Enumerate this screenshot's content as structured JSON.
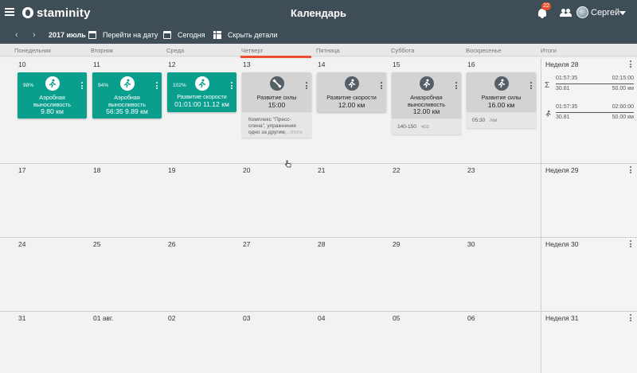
{
  "app": {
    "logo_text": "staminity",
    "title": "Календарь",
    "notifications_count": "22",
    "user_name": "Сергей"
  },
  "toolbar": {
    "prev": "‹",
    "next": "›",
    "month": "2017 июль",
    "goto_date": "Перейти на дату",
    "today": "Сегодня",
    "hide_details": "Скрыть детали"
  },
  "weekdays": [
    "Понедельник",
    "Вторник",
    "Среда",
    "Четверг",
    "Пятница",
    "Суббота",
    "Воскресенье"
  ],
  "totals_header": "Итоги",
  "weeks": [
    {
      "label": "Неделя 28",
      "days": [
        "10",
        "11",
        "12",
        "13",
        "14",
        "15",
        "16"
      ],
      "totals": {
        "sum": {
          "actual_time": "01:57:35",
          "plan_time": "02:15:00",
          "actual_dist": "30.81",
          "plan_dist": "50.00 км"
        },
        "run": {
          "actual_time": "01:57:35",
          "plan_time": "02:00:00",
          "actual_dist": "30.81",
          "plan_dist": "50.00 км"
        }
      }
    },
    {
      "label": "Неделя 29",
      "days": [
        "17",
        "18",
        "19",
        "20",
        "21",
        "22",
        "23"
      ]
    },
    {
      "label": "Неделя 30",
      "days": [
        "24",
        "25",
        "26",
        "27",
        "28",
        "29",
        "30"
      ]
    },
    {
      "label": "Неделя 31",
      "days": [
        "31",
        "01 авг.",
        "02",
        "03",
        "04",
        "05",
        "06"
      ]
    }
  ],
  "workouts": [
    {
      "status": "done",
      "icon": "run-icon",
      "percent": "98%",
      "title": "Аэробная выносливость",
      "value": "9.80 км"
    },
    {
      "status": "done",
      "icon": "run-icon",
      "percent": "94%",
      "title": "Аэробная выносливость",
      "value": "56:35  9.89 км"
    },
    {
      "status": "done",
      "icon": "run-icon",
      "percent": "102%",
      "title": "Развитие скорости",
      "value": "01:01:00  11.12 км"
    },
    {
      "status": "planned",
      "icon": "strength-icon",
      "title": "Развитие силы",
      "value": "15:00",
      "note": "Комплекс \"Пресс-спина\", упражнения одно за другим,",
      "more": "...more"
    },
    {
      "status": "planned",
      "icon": "run-icon",
      "title": "Развитие скорости",
      "value": "12.00 км"
    },
    {
      "status": "planned",
      "icon": "run-icon",
      "title": "Анаэробная выносливость",
      "value": "12.00 км",
      "detail": "140-150",
      "detail_unit": "чсс"
    },
    {
      "status": "planned",
      "icon": "run-icon",
      "title": "Развитие силы",
      "value": "16.00 км",
      "detail": "05:30",
      "detail_unit": "/км"
    }
  ],
  "colors": {
    "appbar": "#3f4d57",
    "done_card": "#0a9e8c",
    "planned_card": "#d3d3d3",
    "today_accent": "#e8512f"
  }
}
